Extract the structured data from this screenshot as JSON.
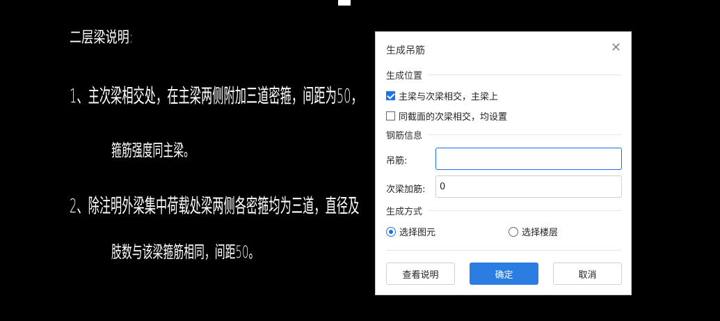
{
  "drawing": {
    "title": "二层梁说明:",
    "line1": "1、主次梁相交处，在主梁两侧附加三道密箍，间距为50，",
    "line1_cont": "箍筋强度同主梁。",
    "line2": "2、除注明外梁集中荷载处梁两侧各密箍均为三道，直径及",
    "line2_cont": "肢数与该梁箍筋相同，间距50。"
  },
  "dialog": {
    "title": "生成吊筋",
    "close_icon": "close-icon",
    "section_position": "生成位置",
    "checkbox_main": {
      "label": "主梁与次梁相交，主梁上",
      "checked": true
    },
    "checkbox_same": {
      "label": "同截面的次梁相交，均设置",
      "checked": false
    },
    "section_rebar": "钢筋信息",
    "hanger_label": "吊筋:",
    "hanger_value": "",
    "secondary_label": "次梁加筋:",
    "secondary_value": "0",
    "section_method": "生成方式",
    "radio_element": {
      "label": "选择图元",
      "selected": true
    },
    "radio_floor": {
      "label": "选择楼层",
      "selected": false
    },
    "btn_help": "查看说明",
    "btn_ok": "确定",
    "btn_cancel": "取消"
  },
  "colors": {
    "accent": "#2b7de1",
    "background": "#000000"
  }
}
